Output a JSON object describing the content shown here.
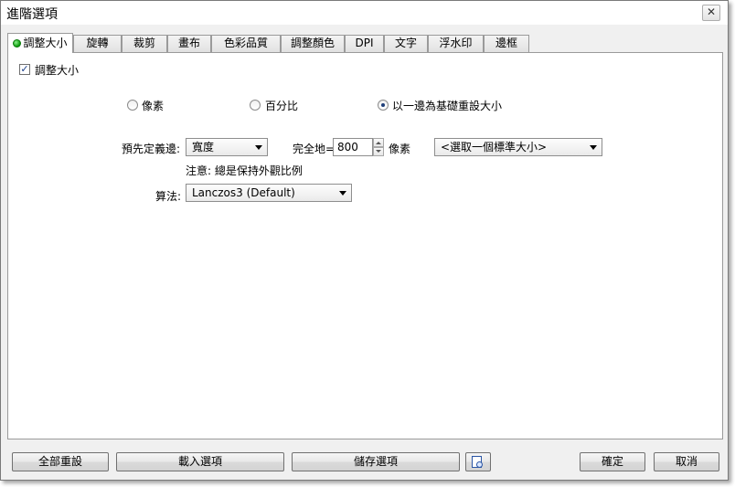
{
  "window": {
    "title": "進階選項",
    "close_label": "✕"
  },
  "tabs": [
    {
      "label": "調整大小",
      "active": true
    },
    {
      "label": "旋轉"
    },
    {
      "label": "裁剪"
    },
    {
      "label": "畫布"
    },
    {
      "label": "色彩品質"
    },
    {
      "label": "調整顏色"
    },
    {
      "label": "DPI"
    },
    {
      "label": "文字"
    },
    {
      "label": "浮水印"
    },
    {
      "label": "邊框"
    }
  ],
  "resize": {
    "enable_label": "調整大小",
    "enable_checked": true,
    "mode_options": [
      {
        "label": "像素",
        "checked": false
      },
      {
        "label": "百分比",
        "checked": false
      },
      {
        "label": "以一邊為基礎重設大小",
        "checked": true
      }
    ],
    "predefined_label": "預先定義邊:",
    "predefined_value": "寬度",
    "exactly_label": "完全地=",
    "size_value": "800",
    "unit_label": "像素",
    "standard_size_value": "<選取一個標準大小>",
    "note": "注意: 總是保持外觀比例",
    "algorithm_label": "算法:",
    "algorithm_value": "Lanczos3 (Default)"
  },
  "footer": {
    "reset_all": "全部重設",
    "load_options": "載入選項",
    "save_options": "儲存選項",
    "ok": "確定",
    "cancel": "取消"
  }
}
